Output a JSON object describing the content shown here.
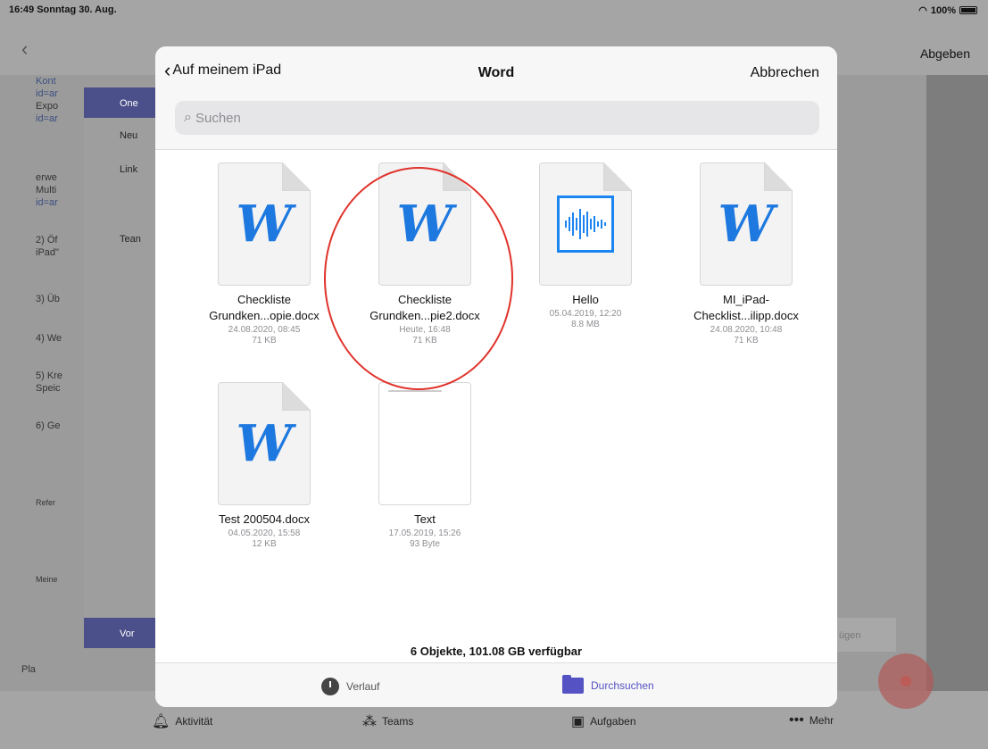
{
  "status": {
    "time_date": "16:49  Sonntag 30. Aug.",
    "battery": "100%"
  },
  "nav": {
    "submit_label": "Abgeben"
  },
  "background": {
    "lines": [
      "Kont",
      "id=ar",
      "Expo",
      "id=ar",
      "erwe",
      "Multi",
      "id=ar",
      "2) Öf",
      "iPad\"",
      "3) Üb",
      "4) We",
      "5) Kre",
      "Speic",
      "6) Ge",
      "Refer",
      "Meine"
    ],
    "menu": [
      "One",
      "Neu",
      "Link",
      "Tean",
      "Vor"
    ],
    "add_button": "ügen",
    "planner": "Pla"
  },
  "picker": {
    "back_label": "Auf meinem iPad",
    "title": "Word",
    "cancel_label": "Abbrechen",
    "search_placeholder": "Suchen",
    "files": [
      {
        "name1": "Checkliste",
        "name2": "Grundken...opie.docx",
        "date": "24.08.2020, 08:45",
        "size": "71 KB",
        "icon": "word-icon"
      },
      {
        "name1": "Checkliste",
        "name2": "Grundken...pie2.docx",
        "date": "Heute, 16:48",
        "size": "71 KB",
        "icon": "word-icon"
      },
      {
        "name1": "Hello",
        "name2": "",
        "date": "05.04.2019, 12:20",
        "size": "8.8 MB",
        "icon": "audio-icon"
      },
      {
        "name1": "MI_iPad-",
        "name2": "Checklist...ilipp.docx",
        "date": "24.08.2020, 10:48",
        "size": "71 KB",
        "icon": "word-icon"
      },
      {
        "name1": "Test 200504.docx",
        "name2": "",
        "date": "04.05.2020, 15:58",
        "size": "12 KB",
        "icon": "word-icon"
      },
      {
        "name1": "Text",
        "name2": "",
        "date": "17.05.2019, 15:26",
        "size": "93 Byte",
        "icon": "text-file-icon"
      }
    ],
    "word_glyph": "W",
    "summary": "6 Objekte, 101.08 GB verfügbar",
    "tabs": {
      "recent": "Verlauf",
      "browse": "Durchsuchen"
    },
    "accent": "#5553c4"
  },
  "tabbar": {
    "activity": "Aktivität",
    "teams": "Teams",
    "tasks": "Aufgaben",
    "more": "Mehr"
  }
}
